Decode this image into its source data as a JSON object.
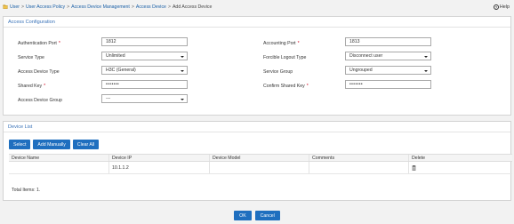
{
  "breadcrumb": {
    "items": [
      "User",
      "User Access Policy",
      "Access Device Management",
      "Access Device"
    ],
    "current": "Add Access Device",
    "separator": ">"
  },
  "help": {
    "label": "Help"
  },
  "config": {
    "title": "Access Configuration",
    "auth_port": {
      "label": "Authentication Port",
      "required": "*",
      "value": "1812"
    },
    "acct_port": {
      "label": "Accounting Port",
      "required": "*",
      "value": "1813"
    },
    "service_type": {
      "label": "Service Type",
      "value": "Unlimited"
    },
    "forcible_logout": {
      "label": "Forcible Logout Type",
      "value": "Disconnect user"
    },
    "device_type": {
      "label": "Access Device Type",
      "value": "H3C (General)"
    },
    "service_group": {
      "label": "Service Group",
      "value": "Ungrouped"
    },
    "shared_key": {
      "label": "Shared Key",
      "required": "*",
      "value": "•••••••"
    },
    "confirm_key": {
      "label": "Confirm Shared Key",
      "required": "*",
      "value": "•••••••"
    },
    "device_group": {
      "label": "Access Device Group",
      "value": "---"
    }
  },
  "devices": {
    "title": "Device List",
    "buttons": {
      "select": "Select",
      "add_manually": "Add Manually",
      "clear_all": "Clear All"
    },
    "columns": [
      "Device Name",
      "Device IP",
      "Device Model",
      "Comments",
      "Delete"
    ],
    "rows": [
      {
        "name": "",
        "ip": "10.1.1.2",
        "model": "",
        "comments": ""
      }
    ],
    "total": "Total Items: 1."
  },
  "footer": {
    "ok": "OK",
    "cancel": "Cancel"
  },
  "colors": {
    "accent": "#1f6fbf",
    "title": "#3a73b8",
    "link": "#1a5fa6",
    "required": "#d0021b"
  }
}
